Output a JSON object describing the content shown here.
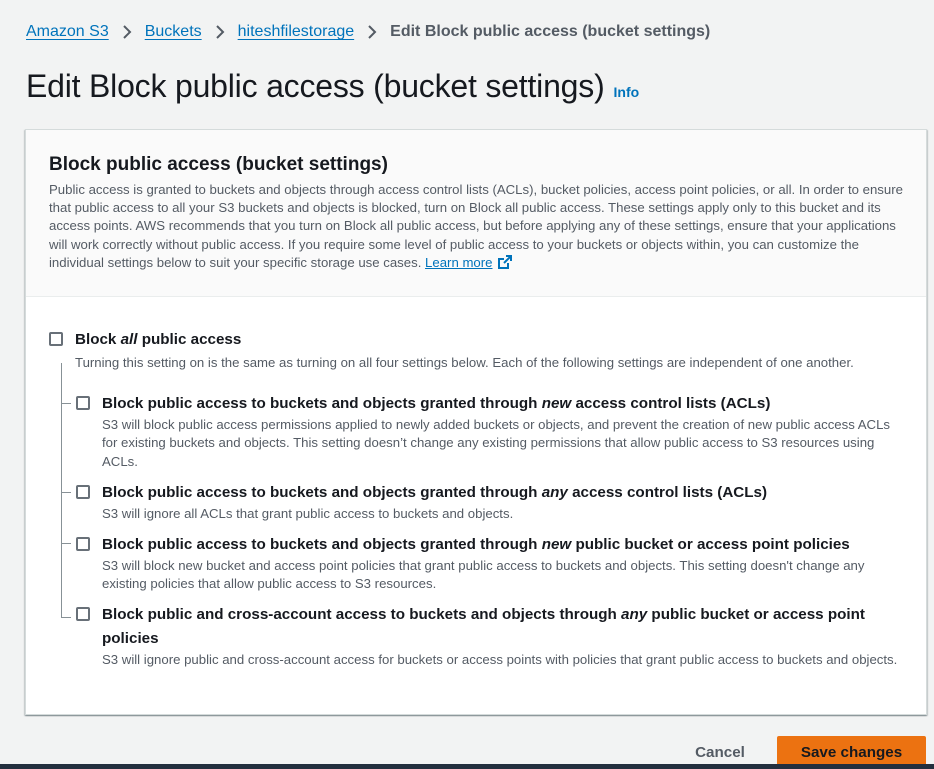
{
  "breadcrumb": {
    "items": [
      "Amazon S3",
      "Buckets",
      "hiteshfilestorage"
    ],
    "current": "Edit Block public access (bucket settings)"
  },
  "page": {
    "title": "Edit Block public access (bucket settings)",
    "info_label": "Info"
  },
  "panel": {
    "title": "Block public access (bucket settings)",
    "description": "Public access is granted to buckets and objects through access control lists (ACLs), bucket policies, access point policies, or all. In order to ensure that public access to all your S3 buckets and objects is blocked, turn on Block all public access. These settings apply only to this bucket and its access points. AWS recommends that you turn on Block all public access, but before applying any of these settings, ensure that your applications will work correctly without public access. If you require some level of public access to your buckets or objects within, you can customize the individual settings below to suit your specific storage use cases.",
    "learn_more": "Learn more"
  },
  "block_all": {
    "label_before": "Block ",
    "label_em": "all",
    "label_after": " public access",
    "description": "Turning this setting on is the same as turning on all four settings below. Each of the following settings are independent of one another.",
    "checked": false
  },
  "options": [
    {
      "label_before": "Block public access to buckets and objects granted through ",
      "label_em": "new",
      "label_after": " access control lists (ACLs)",
      "description": "S3 will block public access permissions applied to newly added buckets or objects, and prevent the creation of new public access ACLs for existing buckets and objects. This setting doesn’t change any existing permissions that allow public access to S3 resources using ACLs.",
      "checked": false
    },
    {
      "label_before": "Block public access to buckets and objects granted through ",
      "label_em": "any",
      "label_after": " access control lists (ACLs)",
      "description": "S3 will ignore all ACLs that grant public access to buckets and objects.",
      "checked": false
    },
    {
      "label_before": "Block public access to buckets and objects granted through ",
      "label_em": "new",
      "label_after": " public bucket or access point policies",
      "description": "S3 will block new bucket and access point policies that grant public access to buckets and objects. This setting doesn't change any existing policies that allow public access to S3 resources.",
      "checked": false
    },
    {
      "label_before": "Block public and cross-account access to buckets and objects through ",
      "label_em": "any",
      "label_after": " public bucket or access point policies",
      "description": "S3 will ignore public and cross-account access for buckets or access points with policies that grant public access to buckets and objects.",
      "checked": false
    }
  ],
  "footer": {
    "cancel_label": "Cancel",
    "save_label": "Save changes"
  },
  "colors": {
    "link": "#0073bb",
    "primary_button": "#ec7211",
    "page_background": "#f2f3f3",
    "bottom_bar": "#232f3e"
  },
  "icons": [
    "chevron-right-icon",
    "external-link-icon",
    "checkbox-unchecked"
  ]
}
